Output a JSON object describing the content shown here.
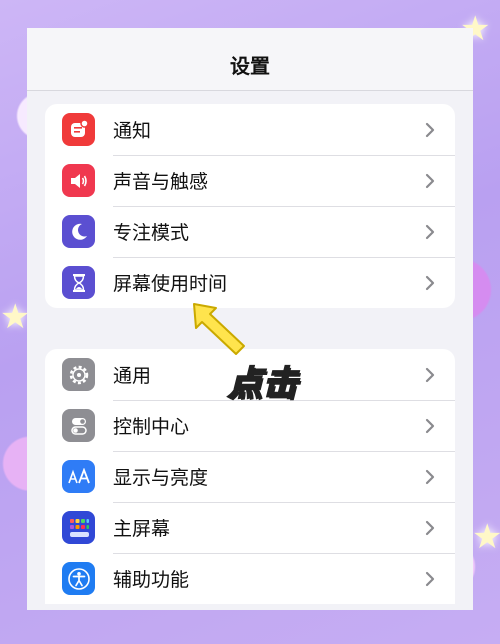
{
  "header": {
    "title": "设置"
  },
  "groups": [
    {
      "items": [
        {
          "label": "通知",
          "icon": "bell-icon",
          "color": "#f03a3a"
        },
        {
          "label": "声音与触感",
          "icon": "speaker-icon",
          "color": "#f0384f"
        },
        {
          "label": "专注模式",
          "icon": "moon-icon",
          "color": "#5b4fd1"
        },
        {
          "label": "屏幕使用时间",
          "icon": "hourglass-icon",
          "color": "#5b4fd1"
        }
      ]
    },
    {
      "items": [
        {
          "label": "通用",
          "icon": "gear-icon",
          "color": "#8e8e93"
        },
        {
          "label": "控制中心",
          "icon": "toggles-icon",
          "color": "#8e8e93"
        },
        {
          "label": "显示与亮度",
          "icon": "text-size-icon",
          "color": "#2f7cf6"
        },
        {
          "label": "主屏幕",
          "icon": "home-grid-icon",
          "color": "#3048d6"
        },
        {
          "label": "辅助功能",
          "icon": "accessibility-icon",
          "color": "#1f7cf2"
        }
      ]
    }
  ],
  "annotation": {
    "text": "点击",
    "color": "#ffe44d"
  }
}
